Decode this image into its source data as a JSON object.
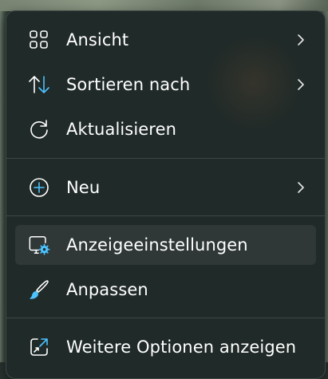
{
  "menu": {
    "items": [
      {
        "label": "Ansicht",
        "icon": "grid-view-icon",
        "submenu": true
      },
      {
        "label": "Sortieren nach",
        "icon": "sort-arrows-icon",
        "submenu": true
      },
      {
        "label": "Aktualisieren",
        "icon": "refresh-icon",
        "submenu": false
      },
      {
        "label": "Neu",
        "icon": "add-circle-icon",
        "submenu": true
      },
      {
        "label": "Anzeigeeinstellungen",
        "icon": "display-settings-icon",
        "submenu": false,
        "highlighted": true
      },
      {
        "label": "Anpassen",
        "icon": "paintbrush-icon",
        "submenu": false
      },
      {
        "label": "Weitere Optionen anzeigen",
        "icon": "open-external-icon",
        "submenu": false
      }
    ]
  },
  "colors": {
    "menu_background": "#202a28",
    "hover_background": "#2f3837",
    "accent": "#4cc2ff",
    "text": "#ffffff"
  }
}
